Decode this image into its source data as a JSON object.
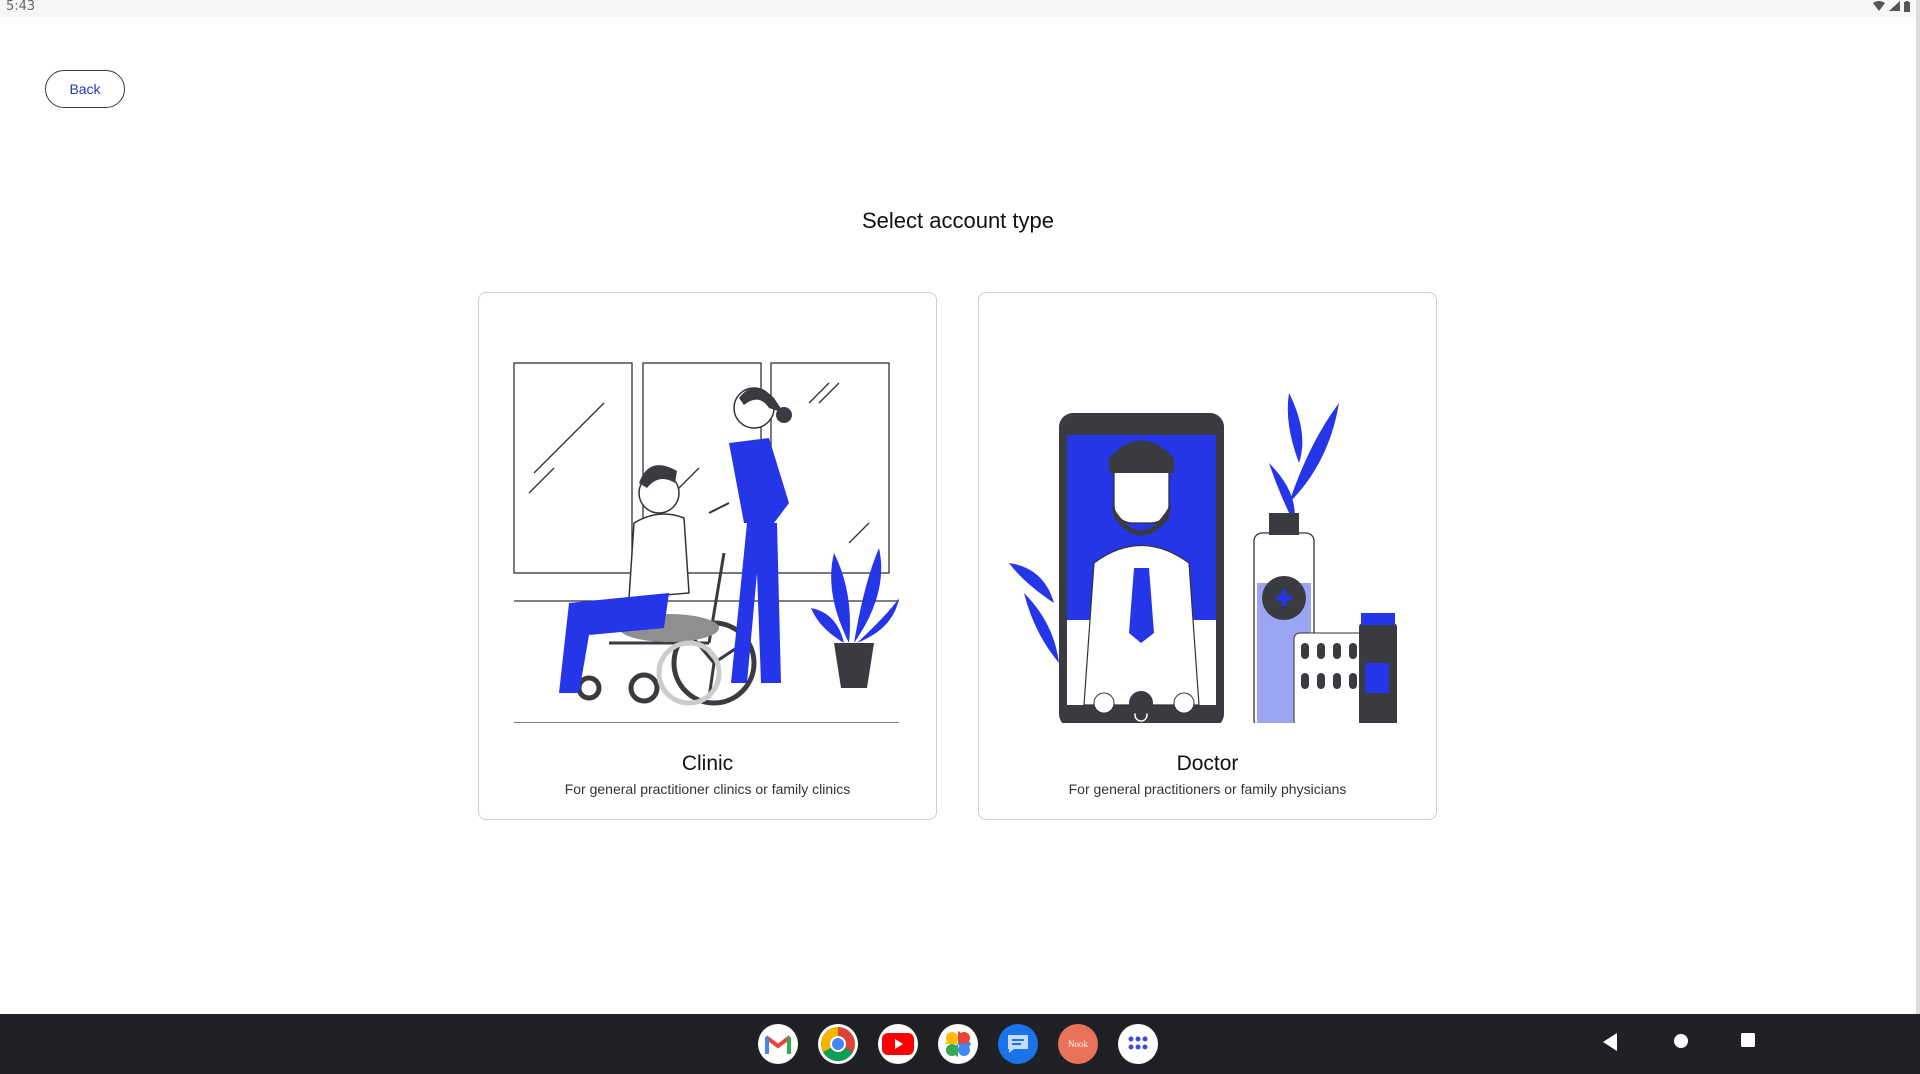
{
  "status_bar": {
    "time": "5:43"
  },
  "header": {
    "back_label": "Back"
  },
  "main": {
    "title": "Select account type",
    "cards": [
      {
        "title": "Clinic",
        "subtitle": "For general practitioner clinics or family clinics"
      },
      {
        "title": "Doctor",
        "subtitle": "For general practitioners or family physicians"
      }
    ]
  },
  "dock": {
    "apps": [
      {
        "name": "Gmail",
        "icon": "gmail-icon"
      },
      {
        "name": "Chrome",
        "icon": "chrome-icon"
      },
      {
        "name": "YouTube",
        "icon": "youtube-icon"
      },
      {
        "name": "Photos",
        "icon": "photos-icon"
      },
      {
        "name": "Messages",
        "icon": "messages-icon"
      },
      {
        "name": "Nook",
        "icon": "nook-icon",
        "label": "Nook"
      },
      {
        "name": "App drawer",
        "icon": "app-drawer-icon"
      }
    ]
  },
  "colors": {
    "accent": "#2436e8",
    "text_link": "#1f3bb3",
    "navbar": "#202124"
  }
}
